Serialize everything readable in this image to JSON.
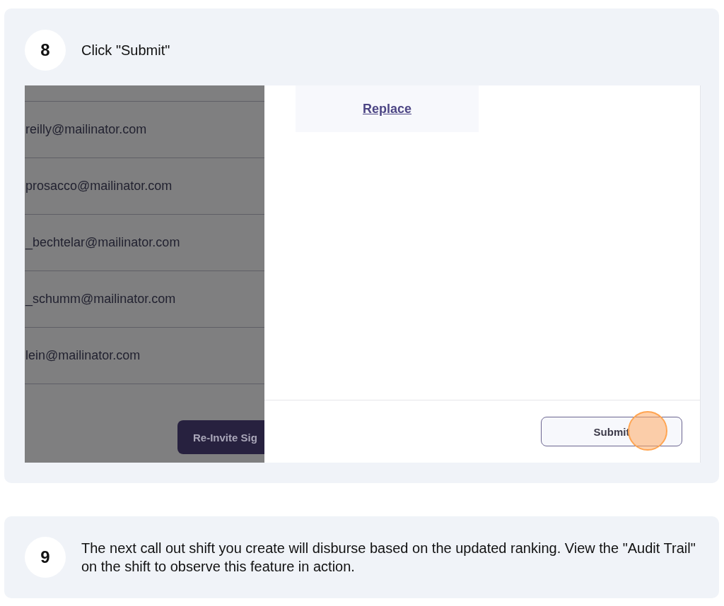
{
  "steps": [
    {
      "number": "8",
      "kind": "screenshot",
      "title": "Click \"Submit\"",
      "screen": {
        "emails": [
          "reilly@mailinator.com",
          "prosacco@mailinator.com",
          "_bechtelar@mailinator.com",
          "_schumm@mailinator.com",
          "lein@mailinator.com"
        ],
        "reinvite_button": "Re-Invite Sig",
        "replace_link": "Replace",
        "submit_button": "Submit"
      }
    },
    {
      "number": "9",
      "kind": "text",
      "text": "The next call out shift you create will disburse based on the updated ranking. View the \"Audit Trail\" on the shift to observe this feature in action."
    }
  ]
}
